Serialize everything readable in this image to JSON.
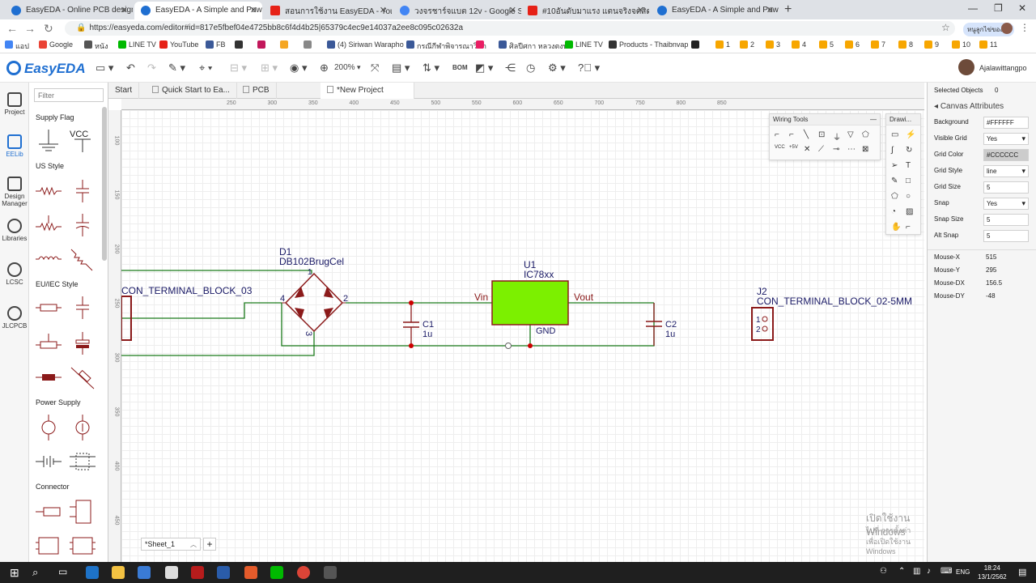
{
  "browser": {
    "tabs": [
      {
        "label": "EasyEDA - Online PCB design & c",
        "color": "#1f6fd1",
        "active": false
      },
      {
        "label": "EasyEDA - A Simple and Powerfu",
        "color": "#1f6fd1",
        "active": true
      },
      {
        "label": "สอนการใช้งาน EasyEDA - YouTube",
        "color": "#e62117",
        "active": false
      },
      {
        "label": "วงจรชาร์จแบต 12v - Google Search",
        "color": "#4285f4",
        "active": false
      },
      {
        "label": "#10อันดับมาแรง แตนจริงจตสิดผงปั้งไม่",
        "color": "#e62117",
        "active": false
      },
      {
        "label": "EasyEDA - A Simple and Powerfu",
        "color": "#1f6fd1",
        "active": false
      }
    ],
    "url": "https://easyeda.com/editor#id=817e5fbef04e4725bb8c6f4d4b25|65379c4ec9e14037a2ee8c095c02632a",
    "bookmarks": [
      {
        "label": "แอป",
        "color": "#4285f4"
      },
      {
        "label": "Google",
        "color": "#ea4335"
      },
      {
        "label": "หนัง",
        "color": "#555"
      },
      {
        "label": "LINE TV",
        "color": "#00b900"
      },
      {
        "label": "YouTube",
        "color": "#e62117"
      },
      {
        "label": "FB",
        "color": "#3b5998"
      },
      {
        "label": "",
        "color": "#333"
      },
      {
        "label": "",
        "color": "#c2185b"
      },
      {
        "label": "",
        "color": "#f5a623"
      },
      {
        "label": "",
        "color": "#888"
      },
      {
        "label": "(4) Siriwan Warapho",
        "color": "#3b5998"
      },
      {
        "label": "กรณีกีฬาพิจารณาวิชา",
        "color": "#3b5998"
      },
      {
        "label": "",
        "color": "#e91e63"
      },
      {
        "label": "ศิลปีศกา หลวงตงษ์",
        "color": "#3b5998"
      },
      {
        "label": "LINE TV",
        "color": "#00b900"
      },
      {
        "label": "Products - Thaibnvap",
        "color": "#333"
      },
      {
        "label": "",
        "color": "#222"
      },
      {
        "label": "1",
        "color": "#f7a600"
      },
      {
        "label": "2",
        "color": "#f7a600"
      },
      {
        "label": "3",
        "color": "#f7a600"
      },
      {
        "label": "4",
        "color": "#f7a600"
      },
      {
        "label": "5",
        "color": "#f7a600"
      },
      {
        "label": "6",
        "color": "#f7a600"
      },
      {
        "label": "7",
        "color": "#f7a600"
      },
      {
        "label": "8",
        "color": "#f7a600"
      },
      {
        "label": "9",
        "color": "#f7a600"
      },
      {
        "label": "10",
        "color": "#f7a600"
      },
      {
        "label": "11",
        "color": "#f7a600"
      }
    ],
    "profile_label": "หนูลูกไข่ของรา"
  },
  "app": {
    "logo": "EasyEDA",
    "zoom": "200%",
    "bom": "BOM",
    "user": "Ajalawittangpo"
  },
  "left_rail": [
    {
      "label": "Project",
      "icon": "folder-icon"
    },
    {
      "label": "EELib",
      "icon": "chip-icon"
    },
    {
      "label": "Design Manager",
      "icon": "tree-icon"
    },
    {
      "label": "Libraries",
      "icon": "search-icon"
    },
    {
      "label": "LCSC",
      "icon": "lcsc-icon"
    },
    {
      "label": "JLCPCB",
      "icon": "jlc-icon"
    }
  ],
  "library": {
    "filter_placeholder": "Filter",
    "sections": [
      "Supply Flag",
      "US Style",
      "EU/IEC Style",
      "Power Supply",
      "Connector"
    ],
    "vcc": "VCC"
  },
  "doc_tabs": [
    {
      "label": "Start"
    },
    {
      "label": "Quick Start to Ea..."
    },
    {
      "label": "PCB"
    },
    {
      "label": "*New Project"
    }
  ],
  "ruler": {
    "top": [
      "250",
      "300",
      "350",
      "400",
      "450",
      "500",
      "550",
      "600",
      "650",
      "700",
      "750",
      "800",
      "850"
    ],
    "left": [
      "100",
      "150",
      "200",
      "250",
      "300",
      "350",
      "400",
      "450"
    ]
  },
  "schematic": {
    "j1_name": "CON_TERMINAL_BLOCK_03",
    "d1_ref": "D1",
    "d1_name": "DB102BrugCel",
    "d1_pin_left": "4",
    "d1_pin_right": "2",
    "d1_pin_top": "1",
    "d1_pin_bottom": "3",
    "c1_ref": "C1",
    "c1_val": "1u",
    "u1_ref": "U1",
    "u1_name": "IC78xx",
    "u1_vin": "Vin",
    "u1_vout": "Vout",
    "u1_gnd": "GND",
    "c2_ref": "C2",
    "c2_val": "1u",
    "j2_ref": "J2",
    "j2_name": "CON_TERMINAL_BLOCK_02-5MM",
    "j2_pin1": "1",
    "j2_pin2": "2",
    "wire_color": "#1a7a1a",
    "part_color": "#8b1a1a",
    "u1_fill": "#7cf000"
  },
  "wiring_tools": {
    "title": "Wiring Tools",
    "vcc": "VCC",
    "v5": "+5V"
  },
  "drawing_tools": {
    "title": "Drawi..."
  },
  "sheet": {
    "label": "*Sheet_1",
    "add": "+"
  },
  "watermark": {
    "line1": "เปิดใช้งาน Windows",
    "line2": "ไปที่ การตั้งค่า เพื่อเปิดใช้งาน Windows"
  },
  "right_panel": {
    "selected_label": "Selected Objects",
    "selected_count": "0",
    "canvas_title": "Canvas Attributes",
    "attrs": [
      {
        "label": "Background",
        "value": "#FFFFFF",
        "select": false
      },
      {
        "label": "Visible Grid",
        "value": "Yes",
        "select": true
      },
      {
        "label": "Grid Color",
        "value": "#CCCCCC",
        "select": false
      },
      {
        "label": "Grid Style",
        "value": "line",
        "select": true
      },
      {
        "label": "Grid Size",
        "value": "5",
        "select": false
      },
      {
        "label": "Snap",
        "value": "Yes",
        "select": true
      },
      {
        "label": "Snap Size",
        "value": "5",
        "select": false
      },
      {
        "label": "Alt Snap",
        "value": "5",
        "select": false
      }
    ],
    "mouse": [
      {
        "label": "Mouse-X",
        "value": "515"
      },
      {
        "label": "Mouse-Y",
        "value": "295"
      },
      {
        "label": "Mouse-DX",
        "value": "156.5"
      },
      {
        "label": "Mouse-DY",
        "value": "-48"
      }
    ]
  },
  "taskbar": {
    "lang": "ENG",
    "time": "18:24",
    "date": "13/1/2562"
  }
}
